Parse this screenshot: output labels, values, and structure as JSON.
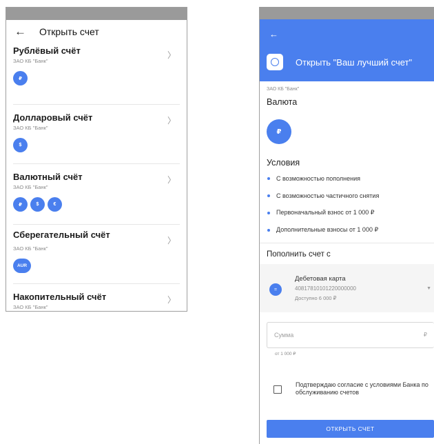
{
  "left": {
    "title": "Открыть счет",
    "back_icon": "arrow-left-icon",
    "accounts": [
      {
        "name": "Рублёвый счёт",
        "bank": "ЗАО КБ \"Банк\"",
        "chips": [
          "₽"
        ]
      },
      {
        "name": "Долларовый счёт",
        "bank": "ЗАО КБ \"Банк\"",
        "chips": [
          "$"
        ]
      },
      {
        "name": "Валютный счёт",
        "bank": "ЗАО КБ \"Банк\"",
        "chips": [
          "₽",
          "$",
          "€"
        ]
      },
      {
        "name": "Сберегательный счёт",
        "bank": "ЗАО КБ \"Банк\"",
        "chips": [
          "AUR"
        ]
      },
      {
        "name": "Накопительный счёт",
        "bank": "ЗАО КБ \"Банк\"",
        "chips": []
      }
    ],
    "chevron": "〉"
  },
  "right": {
    "back_icon": "arrow-left-icon",
    "title": "Открыть \"Ваш лучший счет\"",
    "bank": "ЗАО КБ \"Банк\"",
    "currency_label": "Валюта",
    "currency_chip": "₽",
    "conditions_label": "Условия",
    "conditions": [
      "С возможностью пополнения",
      "С возможностью частичного снятия",
      "Первоначальный взнос от 1 000 ₽",
      "Дополнительные взносы от 1 000 ₽"
    ],
    "topup_label": "Пополнить счет с",
    "card": {
      "name": "Дебетовая карта",
      "number": "40817810101220000000",
      "available": "Доступно 6 000 ₽",
      "icon_glyph": "="
    },
    "amount": {
      "placeholder": "Сумма",
      "currency": "₽",
      "hint": "от 1 000 ₽"
    },
    "consent_text": "Подтверждаю согласие с условиями Банка по обслуживанию счетов",
    "open_button": "ОТКРЫТЬ СЧЕТ"
  },
  "colors": {
    "accent": "#4a7fee",
    "status_bar": "#9a9a9a"
  }
}
